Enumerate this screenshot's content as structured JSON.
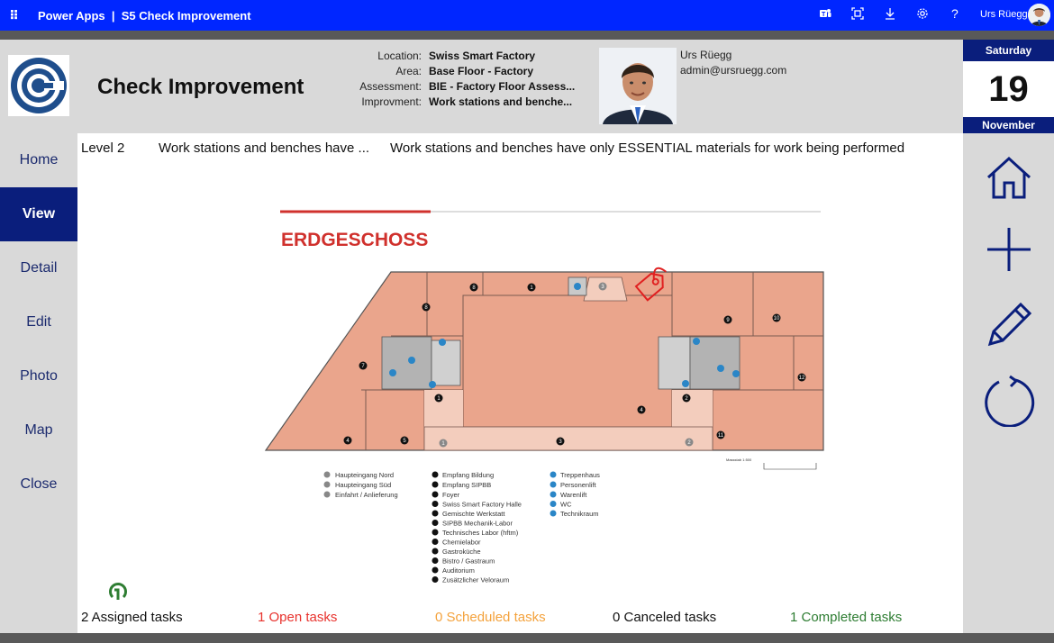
{
  "topbar": {
    "app_name": "Power Apps",
    "separator": "|",
    "app_title": "S5 Check Improvement",
    "user_name": "Urs Rüegg",
    "icons": [
      "waffle-icon",
      "teams-icon",
      "fit-screen-icon",
      "download-icon",
      "settings-icon",
      "help-icon"
    ],
    "help_glyph": "?"
  },
  "header": {
    "title": "Check Improvement",
    "meta": [
      {
        "label": "Location:",
        "value": "Swiss Smart Factory"
      },
      {
        "label": "Area:",
        "value": "Base Floor - Factory"
      },
      {
        "label": "Assessment:",
        "value": "BIE - Factory Floor Assess..."
      },
      {
        "label": "Improvment:",
        "value": "Work stations and benche..."
      }
    ],
    "user": {
      "name": "Urs Rüegg",
      "email": "admin@ursruegg.com"
    }
  },
  "calendar": {
    "weekday": "Saturday",
    "day": "19",
    "month": "November"
  },
  "nav": {
    "items": [
      {
        "label": "Home",
        "active": false
      },
      {
        "label": "View",
        "active": true
      },
      {
        "label": "Detail",
        "active": false
      },
      {
        "label": "Edit",
        "active": false
      },
      {
        "label": "Photo",
        "active": false
      },
      {
        "label": "Map",
        "active": false
      },
      {
        "label": "Close",
        "active": false
      }
    ]
  },
  "main": {
    "level": "Level 2",
    "short_title": "Work stations and benches have ...",
    "description": "Work stations and benches have only ESSENTIAL materials for work being performed"
  },
  "floorplan": {
    "heading": "ERDGESCHOSS",
    "scale_label": "Massstab 1:500",
    "legend_entrances": [
      "Haupteingang Nord",
      "Haupteingang Süd",
      "Einfahrt / Anlieferung"
    ],
    "legend_rooms": [
      "Empfang Bildung",
      "Empfang SIPBB",
      "Foyer",
      "Swiss Smart Factory Halle",
      "Gemischte Werkstatt",
      "SIPBB Mechanik-Labor",
      "Technisches Labor (hftm)",
      "Chemielabor",
      "Gastroküche",
      "Bistro / Gastraum",
      "Auditorium",
      "Zusätzlicher Veloraum"
    ],
    "legend_services": [
      "Treppenhaus",
      "Personenlift",
      "Warenlift",
      "WC",
      "Technikraum"
    ]
  },
  "tasks": {
    "assigned": "2 Assigned tasks",
    "open": "1 Open tasks",
    "scheduled": "0 Scheduled tasks",
    "canceled": "0 Canceled tasks",
    "completed": "1 Completed tasks"
  },
  "colors": {
    "topbar": "#0026ff",
    "navy": "#0a1e7c",
    "open": "#e8322d",
    "scheduled": "#f4a23c",
    "completed": "#2e7d32",
    "floor": "#eaa58c",
    "heading": "#d0312d"
  }
}
